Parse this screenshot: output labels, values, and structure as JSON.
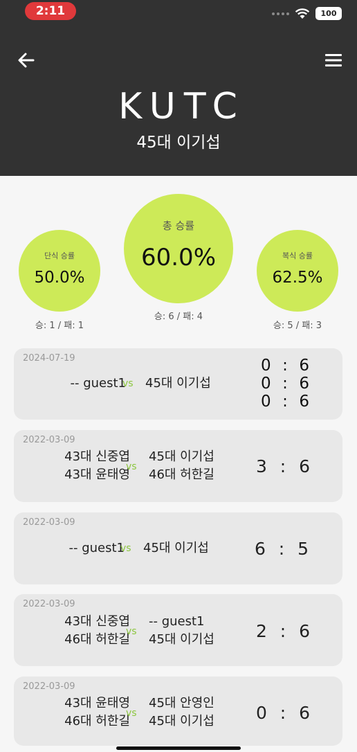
{
  "status_bar": {
    "time": "2:11",
    "battery": "100"
  },
  "header": {
    "title": "KUTC",
    "subtitle": "45대 이기섭"
  },
  "stats": {
    "total": {
      "label": "총 승률",
      "value": "60.0%",
      "record": "승: 6 / 패: 4"
    },
    "singles": {
      "label": "단식 승률",
      "value": "50.0%",
      "record": "승: 1 / 패: 1"
    },
    "doubles": {
      "label": "복식 승률",
      "value": "62.5%",
      "record": "승: 5 / 패: 3"
    }
  },
  "vs_label": "vs",
  "matches": [
    {
      "date": "2024-07-19",
      "team1": [
        "-- guest1"
      ],
      "team2": [
        "45대 이기섭"
      ],
      "scores": [
        [
          "0",
          "6"
        ],
        [
          "0",
          "6"
        ],
        [
          "0",
          "6"
        ]
      ]
    },
    {
      "date": "2022-03-09",
      "team1": [
        "43대 신중엽",
        "43대 윤태영"
      ],
      "team2": [
        "45대 이기섭",
        "46대 허한길"
      ],
      "scores": [
        [
          "3",
          "6"
        ]
      ]
    },
    {
      "date": "2022-03-09",
      "team1": [
        "-- guest1"
      ],
      "team2": [
        "45대 이기섭"
      ],
      "scores": [
        [
          "6",
          "5"
        ]
      ]
    },
    {
      "date": "2022-03-09",
      "team1": [
        "43대 신중엽",
        "46대 허한길"
      ],
      "team2": [
        "-- guest1",
        "45대 이기섭"
      ],
      "scores": [
        [
          "2",
          "6"
        ]
      ]
    },
    {
      "date": "2022-03-09",
      "team1": [
        "43대 윤태영",
        "46대 허한길"
      ],
      "team2": [
        "45대 안영인",
        "45대 이기섭"
      ],
      "scores": [
        [
          "0",
          "6"
        ]
      ]
    }
  ]
}
